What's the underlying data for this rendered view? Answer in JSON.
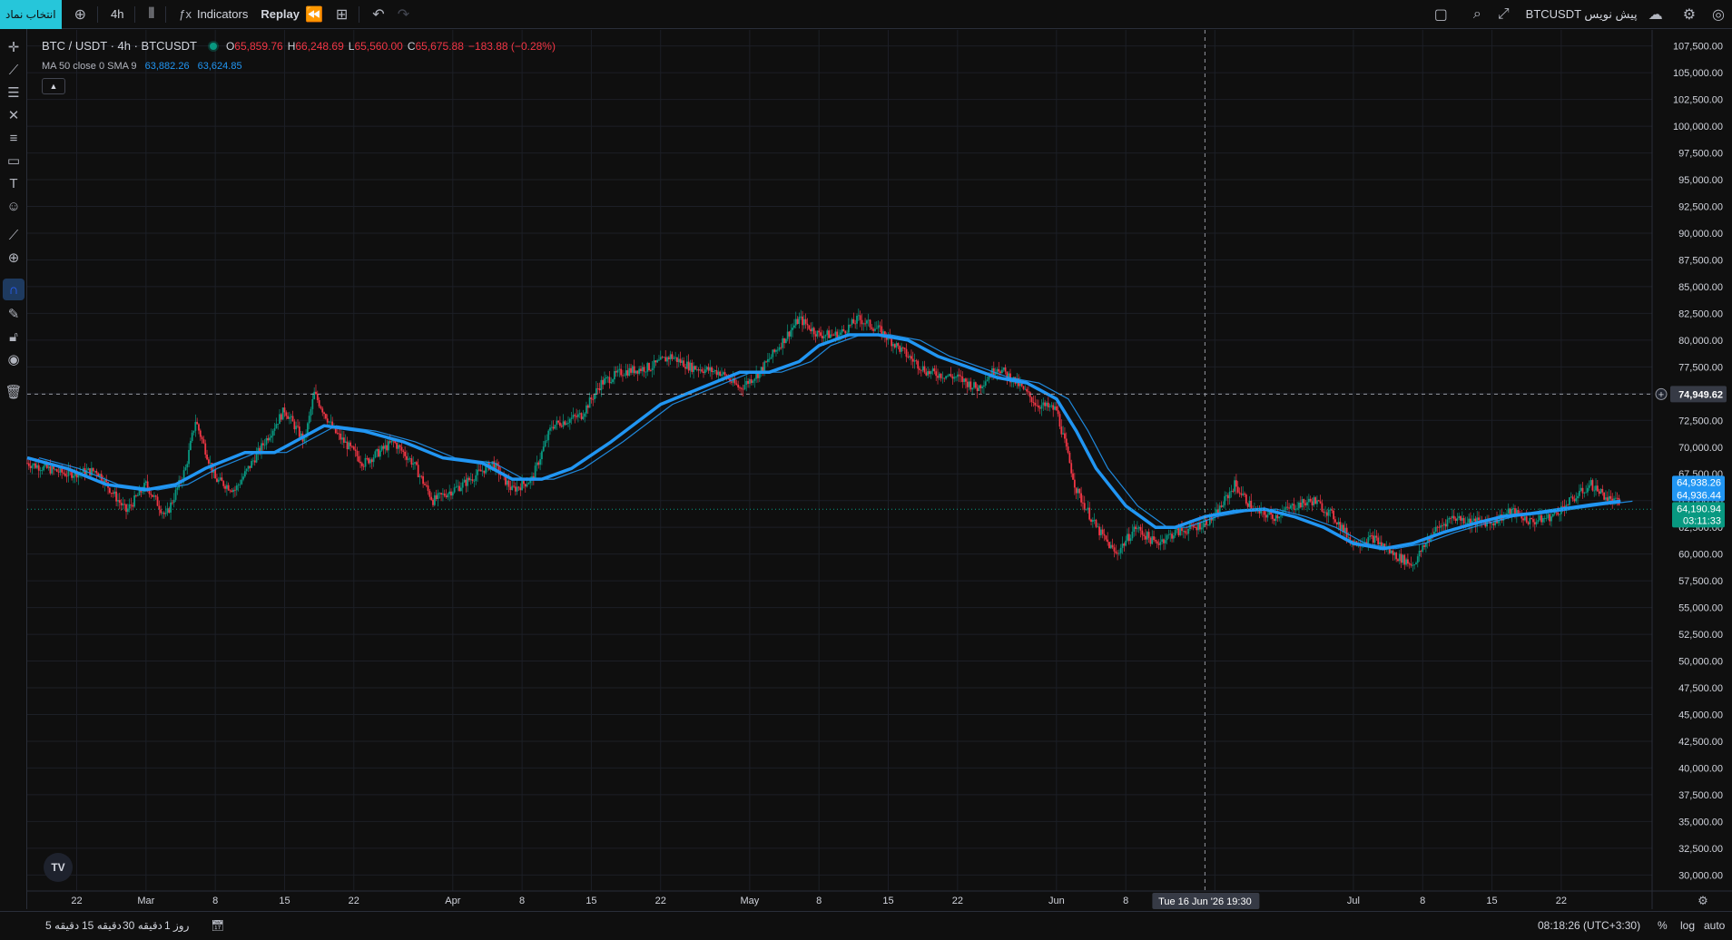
{
  "topbar": {
    "symbol_button": "انتخاب نماد",
    "interval": "4h",
    "indicators_label": "Indicators",
    "replay_label": "Replay",
    "exchange_label": "BTCUSDT پیش نویس"
  },
  "legend": {
    "title": "BTC / USDT · 4h · BTCUSDT",
    "o_label": "O",
    "o": "65,859.76",
    "h_label": "H",
    "h": "66,248.69",
    "l_label": "L",
    "l": "65,560.00",
    "c_label": "C",
    "c": "65,675.88",
    "change": "−183.88 (−0.28%)",
    "ma_name": "MA 50 close 0 SMA 9",
    "ma_value1": "63,882.26",
    "ma_value2": "63,624.85"
  },
  "chart_data": {
    "type": "candlestick",
    "symbol": "BTCUSDT",
    "interval": "4h",
    "y_ticks": [
      "107,500.00",
      "105,000.00",
      "102,500.00",
      "100,000.00",
      "97,500.00",
      "95,000.00",
      "92,500.00",
      "90,000.00",
      "87,500.00",
      "85,000.00",
      "82,500.00",
      "80,000.00",
      "77,500.00",
      "75,000.00",
      "72,500.00",
      "70,000.00",
      "67,500.00",
      "65,000.00",
      "62,500.00",
      "60,000.00",
      "57,500.00",
      "55,000.00",
      "52,500.00",
      "50,000.00",
      "47,500.00",
      "45,000.00",
      "42,500.00",
      "40,000.00",
      "37,500.00",
      "35,000.00",
      "32,500.00",
      "30,000.00"
    ],
    "y_range": [
      28500,
      109000
    ],
    "x_ticks": [
      "22",
      "Mar",
      "8",
      "15",
      "22",
      "Apr",
      "8",
      "15",
      "22",
      "May",
      "8",
      "15",
      "22",
      "Jun",
      "8",
      "2",
      "Jul",
      "8",
      "15",
      "22"
    ],
    "x_tick_days": [
      -7,
      0,
      7,
      14,
      21,
      31,
      38,
      45,
      52,
      61,
      68,
      75,
      82,
      92,
      99,
      108,
      122,
      129,
      136,
      143
    ],
    "x_range_days": [
      -12,
      152
    ],
    "price_path": [
      [
        -12,
        68500
      ],
      [
        -8,
        67500
      ],
      [
        -5,
        67800
      ],
      [
        -2,
        64000
      ],
      [
        0,
        66500
      ],
      [
        2,
        63500
      ],
      [
        4,
        68000
      ],
      [
        5,
        72500
      ],
      [
        7,
        67000
      ],
      [
        9,
        66000
      ],
      [
        11,
        69000
      ],
      [
        14,
        73500
      ],
      [
        16,
        70500
      ],
      [
        17,
        75000
      ],
      [
        19,
        71500
      ],
      [
        22,
        68500
      ],
      [
        25,
        70500
      ],
      [
        27,
        68500
      ],
      [
        29,
        65000
      ],
      [
        32,
        66500
      ],
      [
        35,
        68500
      ],
      [
        37,
        66000
      ],
      [
        39,
        67000
      ],
      [
        41,
        72000
      ],
      [
        44,
        73000
      ],
      [
        46,
        76000
      ],
      [
        48,
        77000
      ],
      [
        51,
        77500
      ],
      [
        53,
        78500
      ],
      [
        55,
        77500
      ],
      [
        58,
        77000
      ],
      [
        60,
        75500
      ],
      [
        62,
        77000
      ],
      [
        64,
        79500
      ],
      [
        66,
        82000
      ],
      [
        68,
        80500
      ],
      [
        70,
        80500
      ],
      [
        72,
        82000
      ],
      [
        74,
        81000
      ],
      [
        77,
        78500
      ],
      [
        79,
        77000
      ],
      [
        82,
        76500
      ],
      [
        84,
        75500
      ],
      [
        86,
        77500
      ],
      [
        88,
        76000
      ],
      [
        90,
        74000
      ],
      [
        92,
        73500
      ],
      [
        94,
        66000
      ],
      [
        96,
        62500
      ],
      [
        98,
        60000
      ],
      [
        100,
        62500
      ],
      [
        102,
        61000
      ],
      [
        104,
        62000
      ],
      [
        106,
        62500
      ],
      [
        108,
        63500
      ],
      [
        110,
        66500
      ],
      [
        112,
        64000
      ],
      [
        114,
        63500
      ],
      [
        116,
        64500
      ],
      [
        118,
        65000
      ],
      [
        120,
        63500
      ],
      [
        122,
        61000
      ],
      [
        124,
        61500
      ],
      [
        126,
        60000
      ],
      [
        128,
        59000
      ],
      [
        130,
        62000
      ],
      [
        132,
        63500
      ],
      [
        134,
        63000
      ],
      [
        136,
        63000
      ],
      [
        138,
        64000
      ],
      [
        140,
        63000
      ],
      [
        142,
        63500
      ],
      [
        144,
        65000
      ],
      [
        146,
        66500
      ],
      [
        148,
        65000
      ],
      [
        149,
        64700
      ]
    ],
    "ma_path": [
      [
        -12,
        69000
      ],
      [
        -8,
        68000
      ],
      [
        -4,
        66500
      ],
      [
        0,
        66000
      ],
      [
        3,
        66500
      ],
      [
        6,
        68000
      ],
      [
        10,
        69500
      ],
      [
        13,
        69500
      ],
      [
        16,
        71000
      ],
      [
        18,
        72000
      ],
      [
        22,
        71500
      ],
      [
        26,
        70500
      ],
      [
        30,
        69000
      ],
      [
        34,
        68500
      ],
      [
        37,
        67000
      ],
      [
        40,
        67000
      ],
      [
        43,
        68000
      ],
      [
        47,
        70500
      ],
      [
        52,
        74000
      ],
      [
        56,
        75500
      ],
      [
        60,
        77000
      ],
      [
        63,
        77000
      ],
      [
        66,
        78000
      ],
      [
        68,
        79500
      ],
      [
        71,
        80500
      ],
      [
        74,
        80500
      ],
      [
        77,
        80000
      ],
      [
        80,
        78500
      ],
      [
        83,
        77500
      ],
      [
        86,
        76500
      ],
      [
        89,
        76000
      ],
      [
        92,
        74500
      ],
      [
        94,
        71500
      ],
      [
        96,
        68000
      ],
      [
        99,
        64500
      ],
      [
        102,
        62500
      ],
      [
        104,
        62500
      ],
      [
        107,
        63500
      ],
      [
        110,
        64000
      ],
      [
        113,
        64200
      ],
      [
        116,
        63500
      ],
      [
        119,
        62500
      ],
      [
        122,
        61000
      ],
      [
        125,
        60500
      ],
      [
        128,
        61000
      ],
      [
        131,
        62000
      ],
      [
        134,
        62800
      ],
      [
        137,
        63500
      ],
      [
        140,
        63800
      ],
      [
        143,
        64200
      ],
      [
        146,
        64600
      ],
      [
        149,
        64938
      ]
    ],
    "series": [
      {
        "name": "MA 50 close 0",
        "color": "#2196f3"
      },
      {
        "name": "SMA 9",
        "color": "#2196f3"
      }
    ],
    "crosshair": {
      "price": "74,949.62",
      "price_value": 74949.62,
      "time_label": "Tue 16 Jun '26   19:30",
      "day": 107
    },
    "price_labels": {
      "ma1": "64,938.26",
      "ma2": "64,936.44",
      "last": "64,190.94",
      "countdown": "03:11:33",
      "last_value": 64190.94
    },
    "colors": {
      "up": "#089981",
      "down": "#f23645",
      "ma": "#2196f3",
      "background": "#0f0f0f",
      "grid": "#1c1f26"
    }
  },
  "bottombar": {
    "ranges": [
      "5 دقیقه",
      "15 دقیقه",
      "30 دقیقه",
      "1 روز"
    ],
    "time": "08:18:26 (UTC+3:30)",
    "pct": "%",
    "log": "log",
    "auto": "auto"
  },
  "icons": [
    "crosshair-icon",
    "trendline-icon",
    "fib-icon",
    "pattern-icon",
    "forecast-icon",
    "shapes-icon",
    "text-icon",
    "emoji-icon",
    "ruler-icon",
    "zoom-icon",
    "magnet-icon",
    "lock-drawing-icon",
    "lock-icon",
    "eye-icon",
    "trash-icon"
  ]
}
